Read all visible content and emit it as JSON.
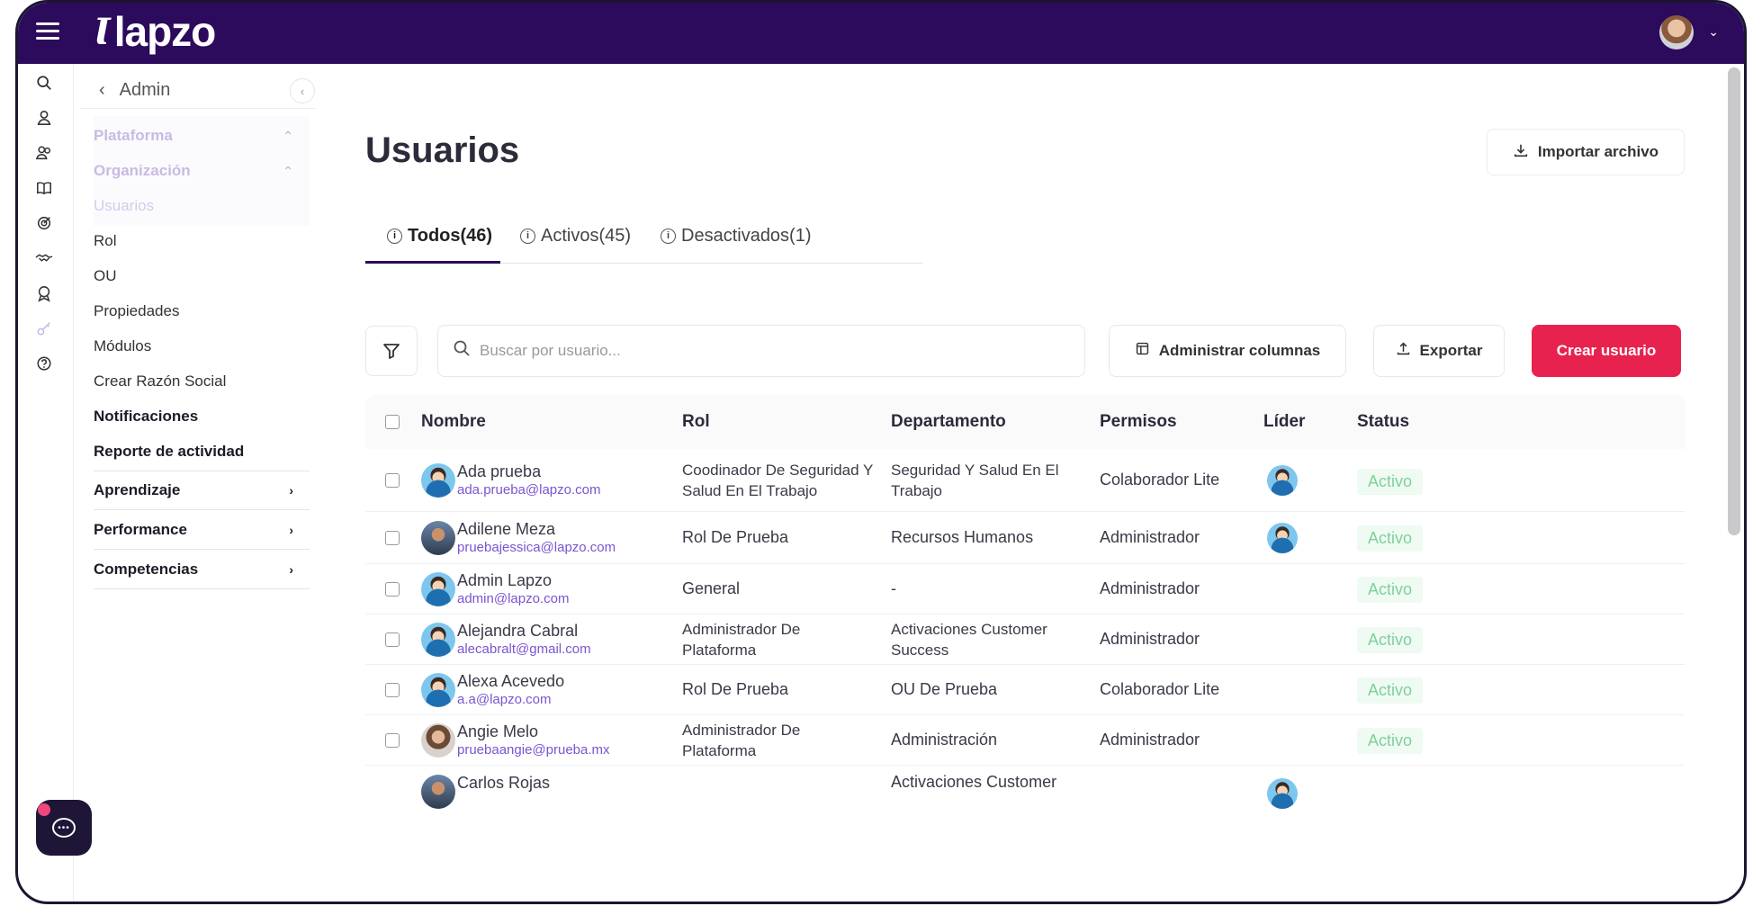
{
  "topbar": {
    "brand": "lapzo",
    "brand_mark": "Ɩ"
  },
  "rail": {
    "icons": [
      "search-icon",
      "user-icon",
      "users-icon",
      "book-icon",
      "target-icon",
      "handshake-icon",
      "badge-icon",
      "key-icon",
      "help-icon"
    ]
  },
  "sidenav": {
    "title": "Admin",
    "items": [
      {
        "label": "Plataforma"
      },
      {
        "label": "Organización"
      },
      {
        "label": "Usuarios"
      },
      {
        "label": "Rol"
      },
      {
        "label": "OU"
      },
      {
        "label": "Propiedades"
      },
      {
        "label": "Módulos"
      },
      {
        "label": "Crear Razón Social"
      },
      {
        "label": "Notificaciones"
      },
      {
        "label": "Reporte de actividad"
      },
      {
        "label": "Aprendizaje"
      },
      {
        "label": "Performance"
      },
      {
        "label": "Competencias"
      }
    ]
  },
  "main": {
    "title": "Usuarios",
    "import_label": "Importar archivo",
    "tabs": [
      {
        "label": "Todos(46)"
      },
      {
        "label": "Activos(45)"
      },
      {
        "label": "Desactivados(1)"
      }
    ],
    "search_placeholder": "Buscar por usuario...",
    "columns_label": "Administrar columnas",
    "export_label": "Exportar",
    "create_label": "Crear usuario"
  },
  "table": {
    "headers": [
      "Nombre",
      "Rol",
      "Departamento",
      "Permisos",
      "Líder",
      "Status"
    ],
    "rows": [
      {
        "name": "Ada prueba",
        "email": "ada.prueba@lapzo.com",
        "rol": "Coodinador De Seguridad Y Salud En El Trabajo",
        "dept": "Seguridad Y Salud En El Trabajo",
        "perm": "Colaborador Lite",
        "status": "Activo"
      },
      {
        "name": "Adilene Meza",
        "email": "pruebajessica@lapzo.com",
        "rol": "Rol De Prueba",
        "dept": "Recursos Humanos",
        "perm": "Administrador",
        "status": "Activo"
      },
      {
        "name": "Admin Lapzo",
        "email": "admin@lapzo.com",
        "rol": "General",
        "dept": "-",
        "perm": "Administrador",
        "status": "Activo"
      },
      {
        "name": "Alejandra Cabral",
        "email": "alecabralt@gmail.com",
        "rol": "Administrador De Plataforma",
        "dept": "Activaciones Customer Success",
        "perm": "Administrador",
        "status": "Activo"
      },
      {
        "name": "Alexa Acevedo",
        "email": "a.a@lapzo.com",
        "rol": "Rol De Prueba",
        "dept": "OU De Prueba",
        "perm": "Colaborador Lite",
        "status": "Activo"
      },
      {
        "name": "Angie Melo",
        "email": "pruebaangie@prueba.mx",
        "rol": "Administrador De Plataforma",
        "dept": "Administración",
        "perm": "Administrador",
        "status": "Activo"
      },
      {
        "name": "Carlos Rojas",
        "email": "",
        "rol": "",
        "dept": "Activaciones Customer",
        "perm": "",
        "status": ""
      }
    ]
  },
  "colors": {
    "topbar": "#2c0a5c",
    "accent": "#e8224f",
    "email": "#7a55d0",
    "status_text": "#7fd09a"
  }
}
